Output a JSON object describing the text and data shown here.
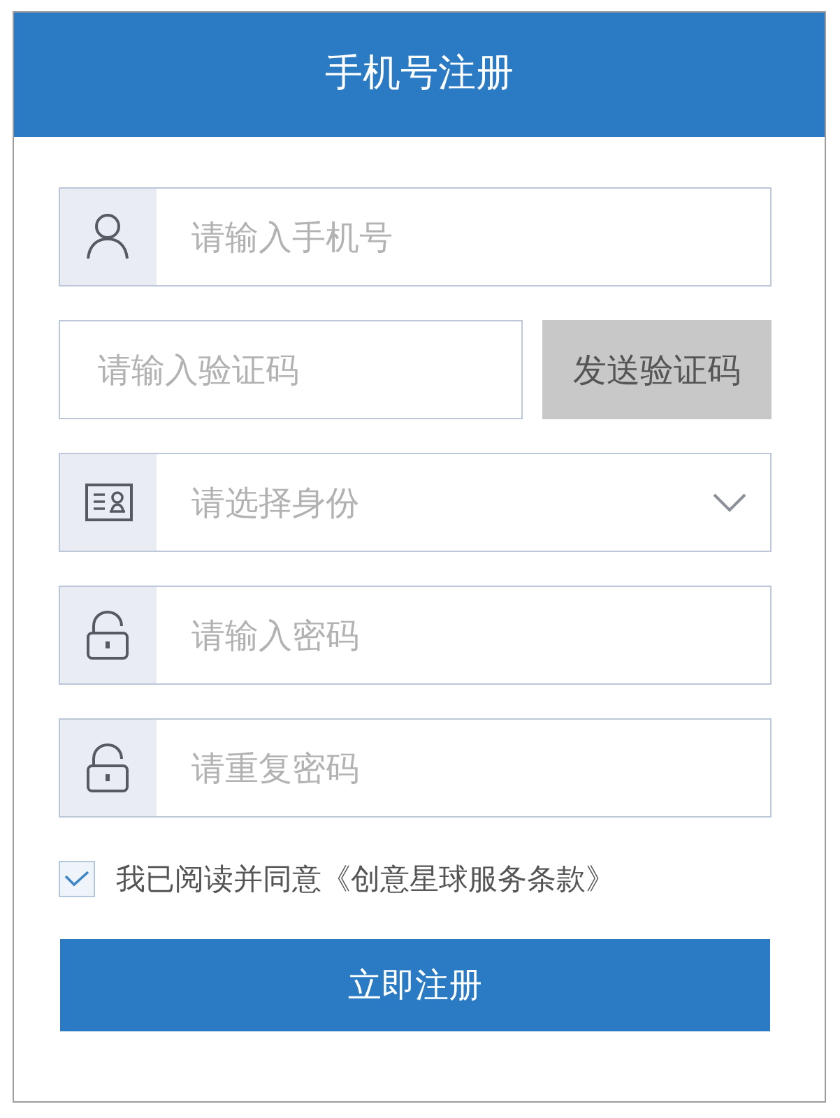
{
  "header": {
    "title": "手机号注册"
  },
  "fields": [
    {
      "kind": "phone",
      "placeholder": "请输入手机号"
    },
    {
      "kind": "code",
      "placeholder": "请输入验证码",
      "button": "发送验证码"
    },
    {
      "kind": "select",
      "placeholder": "请选择身份"
    },
    {
      "kind": "password",
      "placeholder": "请输入密码"
    },
    {
      "kind": "password",
      "placeholder": "请重复密码"
    }
  ],
  "agreement": {
    "checked": true,
    "text": "我已阅读并同意《创意星球服务条款》"
  },
  "submit_button": {
    "label": "立即注册"
  }
}
